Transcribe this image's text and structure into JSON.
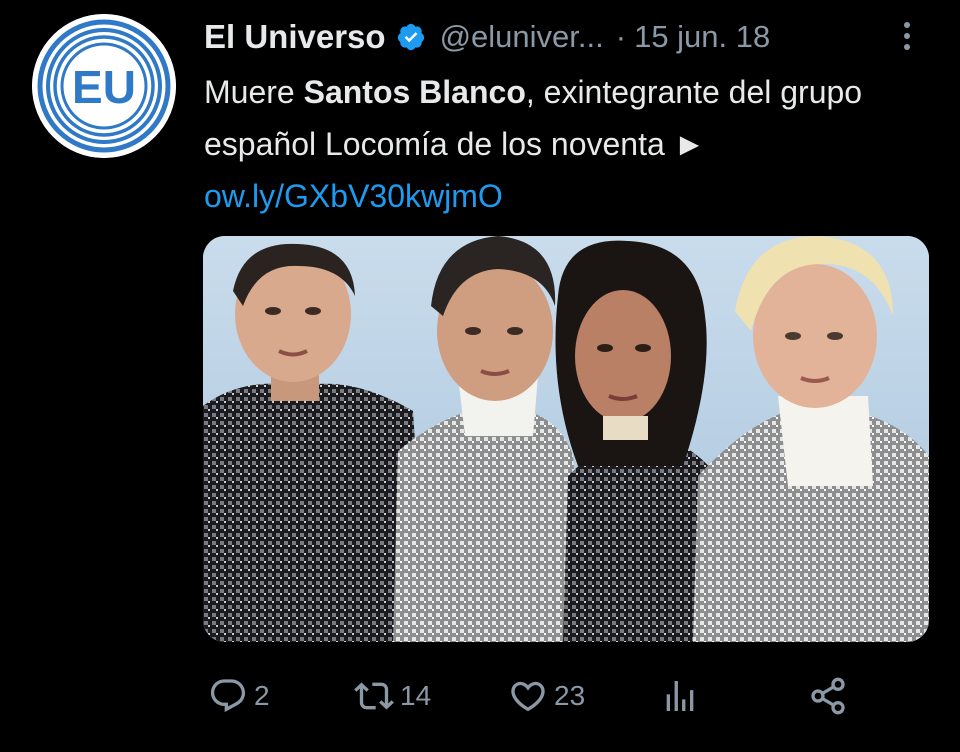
{
  "tweet": {
    "author": {
      "name": "El Universo",
      "handle": "@eluniver...",
      "avatar_text": "EU",
      "verified": true
    },
    "date": "15 jun. 18",
    "separator": "·",
    "text": {
      "part1": "Muere ",
      "bold": "Santos Blanco",
      "part2": ", exintegrante del grupo español Locomía de los noventa ►",
      "link": "ow.ly/GXbV30kwjmO"
    },
    "media": {
      "description_icon": "photo"
    },
    "actions": {
      "replies": "2",
      "retweets": "14",
      "likes": "23"
    }
  },
  "colors": {
    "background": "#000000",
    "text": "#e7e9ea",
    "secondary": "#8b98a5",
    "link": "#1d9bf0",
    "verified": "#1d9bf0",
    "avatar_blue": "#2f79c7"
  },
  "icons": {
    "more": "more-vertical-icon",
    "reply": "reply-icon",
    "retweet": "retweet-icon",
    "like": "heart-icon",
    "views": "analytics-icon",
    "share": "share-icon"
  }
}
